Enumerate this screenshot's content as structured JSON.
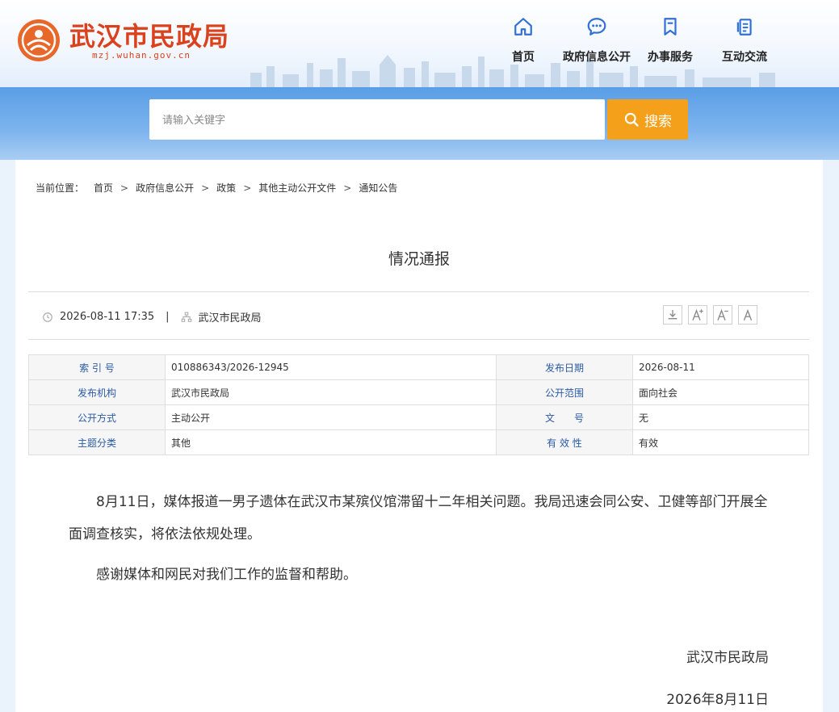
{
  "site": {
    "title": "武汉市民政局",
    "domain": "mzj.wuhan.gov.cn"
  },
  "nav": [
    {
      "label": "首页",
      "icon": "home-icon"
    },
    {
      "label": "政府信息公开",
      "icon": "chat-bubble-icon"
    },
    {
      "label": "办事服务",
      "icon": "bookmark-icon"
    },
    {
      "label": "互动交流",
      "icon": "document-icon"
    }
  ],
  "search": {
    "placeholder": "请输入关键字",
    "button_label": "搜索"
  },
  "breadcrumb": {
    "label": "当前位置：",
    "items": [
      "首页",
      "政府信息公开",
      "政策",
      "其他主动公开文件",
      "通知公告"
    ]
  },
  "article": {
    "title": "情况通报",
    "datetime": "2026-08-11 17:35",
    "source": "武汉市民政局",
    "font_tools": [
      "download-icon",
      "font-increase-icon",
      "font-decrease-icon",
      "font-reset-icon"
    ],
    "info": [
      {
        "k1": "索 引 号",
        "v1": "010886343/2026-12945",
        "k2": "发布日期",
        "v2": "2026-08-11"
      },
      {
        "k1": "发布机构",
        "v1": "武汉市民政局",
        "k2": "公开范围",
        "v2": "面向社会"
      },
      {
        "k1": "公开方式",
        "v1": "主动公开",
        "k2": "文　　号",
        "v2": "无"
      },
      {
        "k1": "主题分类",
        "v1": "其他",
        "k2": "有 效 性",
        "v2": "有效"
      }
    ],
    "paragraphs": [
      "8月11日，媒体报道一男子遗体在武汉市某殡仪馆滞留十二年相关问题。我局迅速会同公安、卫健等部门开展全面调查核实，将依法依规处理。",
      "感谢媒体和网民对我们工作的监督和帮助。"
    ],
    "signature": "武汉市民政局",
    "sign_date": "2026年8月11日"
  },
  "colors": {
    "brand_red": "#d9421d",
    "nav_blue": "#2f6fd6",
    "search_orange": "#f5a01a",
    "band_blue": "#5a9ee6"
  }
}
